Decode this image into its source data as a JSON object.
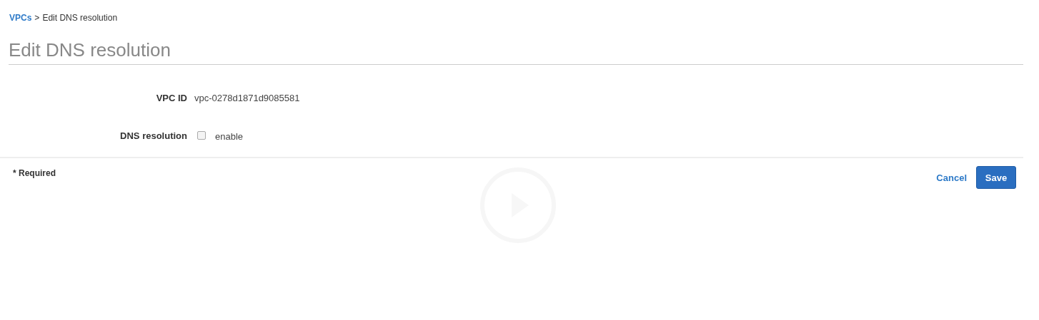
{
  "breadcrumb": {
    "link": "VPCs",
    "separator": ">",
    "current": "Edit DNS resolution"
  },
  "title": "Edit DNS resolution",
  "fields": [
    {
      "kind": "text",
      "label": "VPC ID",
      "value": "vpc-0278d1871d9085581"
    },
    {
      "kind": "checkbox",
      "label": "DNS resolution",
      "option": "enable",
      "checked": false
    }
  ],
  "footer": {
    "required_note": "* Required",
    "cancel": "Cancel",
    "save": "Save"
  }
}
